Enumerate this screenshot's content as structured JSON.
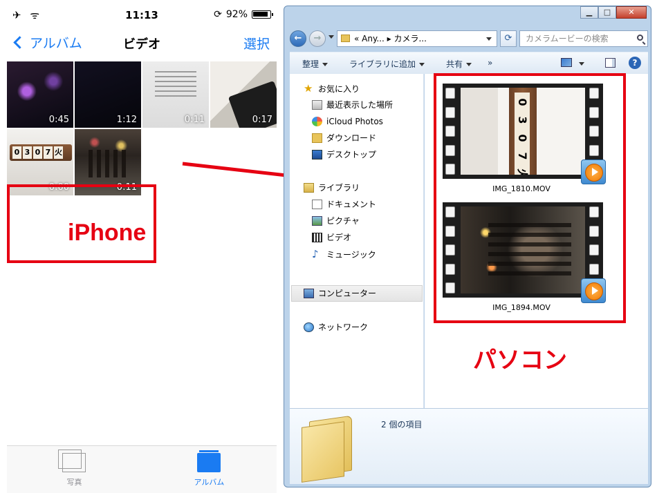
{
  "iphone": {
    "status": {
      "left": "✈ ᯤ",
      "time": "11:13",
      "rotation_lock": "⟳",
      "battery": "92%"
    },
    "nav": {
      "back": "アルバム",
      "title": "ビデオ",
      "action": "選択"
    },
    "videos": [
      {
        "duration": "0:45"
      },
      {
        "duration": "1:12"
      },
      {
        "duration": "0:11"
      },
      {
        "duration": "0:17"
      },
      {
        "duration": "0:00",
        "date_digits": [
          "0",
          "3",
          "0",
          "7",
          "火"
        ]
      },
      {
        "duration": "0:11"
      }
    ],
    "label": "iPhone",
    "tabs": [
      {
        "label": "写真",
        "icon": "photos-icon"
      },
      {
        "label": "アルバム",
        "icon": "albums-icon",
        "active": true
      }
    ]
  },
  "explorer": {
    "window_buttons": {
      "minimize": "▁",
      "maximize": "□",
      "close": "✕"
    },
    "address": "«  Any...  ▸  カメラ...",
    "search_placeholder": "カメラムービーの検索",
    "toolbar": {
      "organize": "整理",
      "add_to_library": "ライブラリに追加",
      "share": "共有",
      "more": "»"
    },
    "nav": {
      "favorites": "お気に入り",
      "recent": "最近表示した場所",
      "icloud": "iCloud Photos",
      "downloads": "ダウンロード",
      "desktop": "デスクトップ",
      "libraries": "ライブラリ",
      "documents": "ドキュメント",
      "pictures": "ピクチャ",
      "videos": "ビデオ",
      "music": "ミュージック",
      "computer": "コンピューター",
      "network": "ネットワーク"
    },
    "files": [
      {
        "name": "IMG_1810.MOV",
        "digits": [
          "0",
          "3",
          "0",
          "7",
          "火"
        ]
      },
      {
        "name": "IMG_1894.MOV"
      }
    ],
    "item_count": "2 個の項目"
  },
  "pc_label": "パソコン",
  "colors": {
    "ios_blue": "#1a7bf2",
    "annotation_red": "#e60012"
  }
}
